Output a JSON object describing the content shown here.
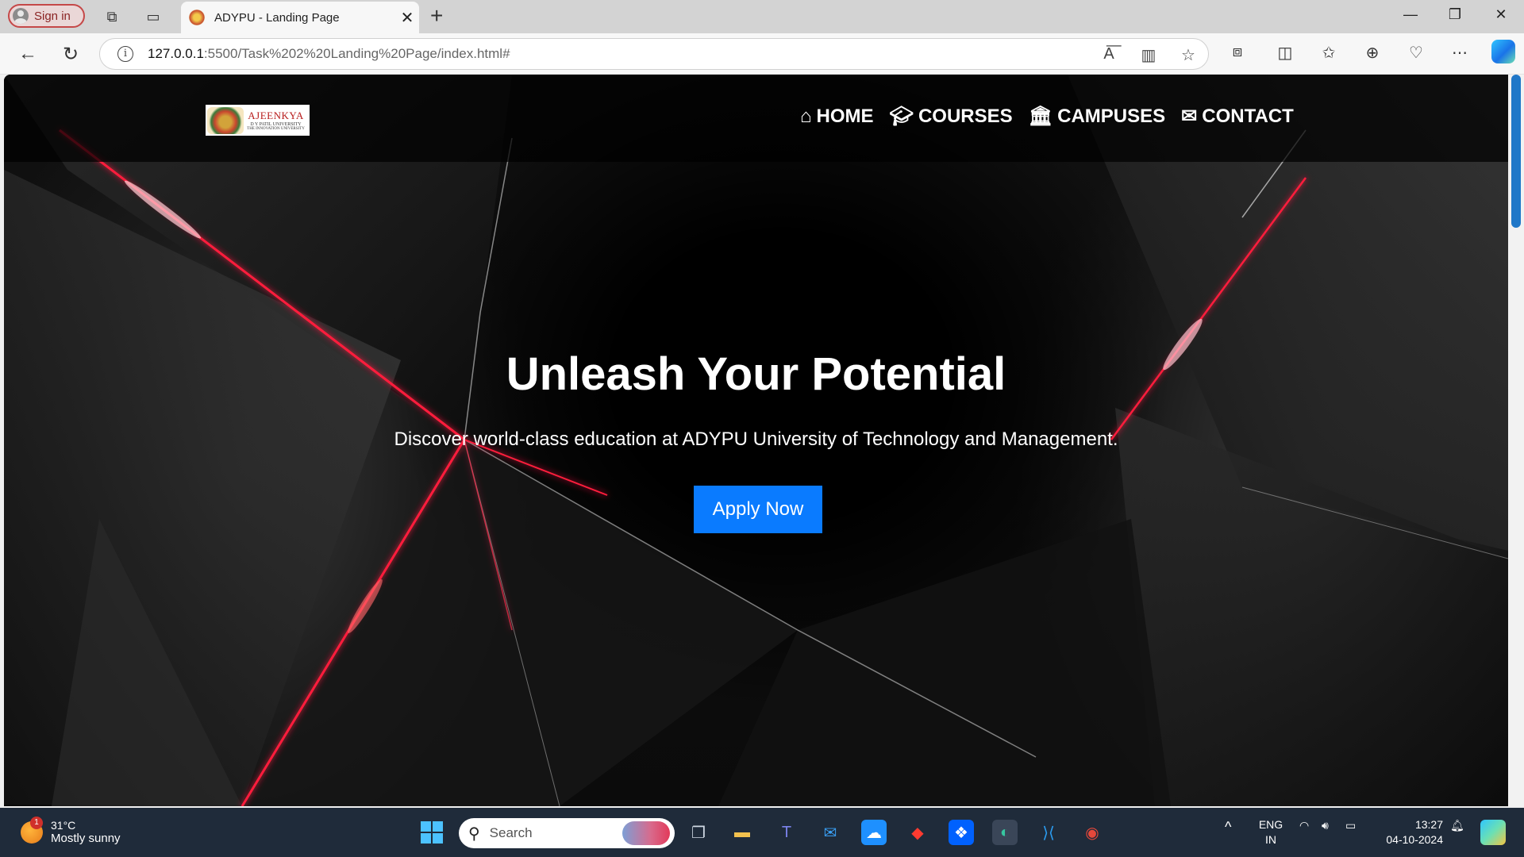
{
  "browser": {
    "signin_label": "Sign in",
    "tab_title": "ADYPU - Landing Page",
    "url_host": "127.0.0.1",
    "url_path": ":5500/Task%202%20Landing%20Page/index.html#"
  },
  "page": {
    "logo": {
      "line1": "AJEENKYA",
      "line2": "D Y PATIL UNIVERSITY",
      "line3": "THE INNOVATION UNIVERSITY"
    },
    "nav": [
      {
        "label": "HOME",
        "icon": "home-icon"
      },
      {
        "label": "COURSES",
        "icon": "graduation-cap-icon"
      },
      {
        "label": "CAMPUSES",
        "icon": "institution-icon"
      },
      {
        "label": "CONTACT",
        "icon": "envelope-icon"
      }
    ],
    "hero": {
      "title": "Unleash Your Potential",
      "subtitle": "Discover world-class education at ADYPU University of Technology and Management.",
      "cta": "Apply Now"
    },
    "colors": {
      "cta": "#0a7bff",
      "accent_red": "#ff1e3c"
    }
  },
  "taskbar": {
    "weather_temp": "31°C",
    "weather_desc": "Mostly sunny",
    "weather_badge": "1",
    "search_placeholder": "Search",
    "lang_top": "ENG",
    "lang_bottom": "IN",
    "time": "13:27",
    "date": "04-10-2024"
  }
}
